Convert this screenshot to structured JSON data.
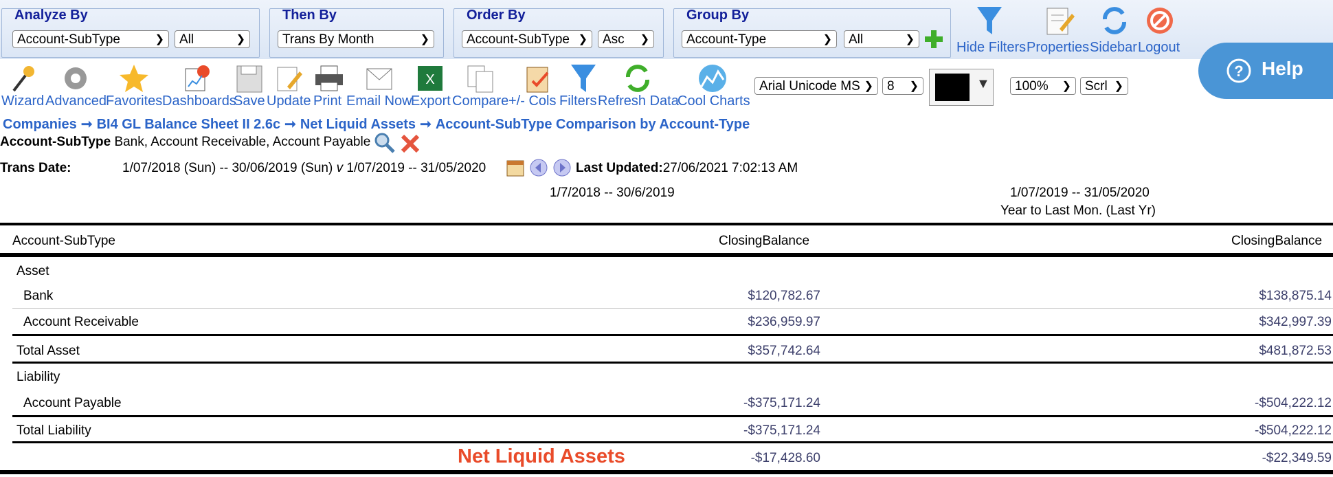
{
  "filters": {
    "analyze_by": {
      "legend": "Analyze By",
      "value": "Account-SubType",
      "sub": "All"
    },
    "then_by": {
      "legend": "Then By",
      "value": "Trans By Month"
    },
    "order_by": {
      "legend": "Order By",
      "value": "Account-SubType",
      "sub": "Asc"
    },
    "group_by": {
      "legend": "Group By",
      "value": "Account-Type",
      "sub": "All"
    }
  },
  "top_actions": [
    "Hide Filters",
    "Properties",
    "Sidebar",
    "Logout"
  ],
  "toolbar": {
    "items": [
      "Wizard",
      "Advanced",
      "Favorites",
      "Dashboards",
      "Save",
      "Update",
      "Print",
      "Email Now",
      "Export",
      "Compare",
      "+/- Cols",
      "Filters",
      "Refresh Data",
      "Cool Charts"
    ],
    "font": "Arial Unicode MS",
    "font_size": "8",
    "zoom": "100%",
    "scroll": "Scrl"
  },
  "help_label": "Help",
  "breadcrumb": [
    "Companies",
    "BI4 GL Balance Sheet II 2.6c",
    "Net Liquid Assets",
    "Account-SubType Comparison by Account-Type"
  ],
  "filter_line": {
    "label": "Account-SubType",
    "values": "Bank, Account Receivable, Account Payable"
  },
  "trans_date": {
    "label": "Trans Date:",
    "range": "1/07/2018 (Sun) -- 30/06/2019 (Sun)",
    "v": "v",
    "range2": "1/07/2019 -- 31/05/2020",
    "last_updated_label": "Last Updated:",
    "last_updated": "27/06/2021 7:02:13 AM"
  },
  "periods": {
    "p1": "1/7/2018 -- 30/6/2019",
    "p2": "1/07/2019 -- 31/05/2020",
    "p2_sub": "Year to Last Mon. (Last Yr)"
  },
  "table": {
    "col_header": "Account-SubType",
    "col1": "ClosingBalance",
    "col2": "ClosingBalance",
    "asset_group": "Asset",
    "bank": {
      "label": "Bank",
      "v1": "$120,782.67",
      "v2": "$138,875.14"
    },
    "ar": {
      "label": "Account Receivable",
      "v1": "$236,959.97",
      "v2": "$342,997.39"
    },
    "total_asset": {
      "label": "Total Asset",
      "v1": "$357,742.64",
      "v2": "$481,872.53"
    },
    "liability_group": "Liability",
    "ap": {
      "label": "Account Payable",
      "v1": "-$375,171.24",
      "v2": "-$504,222.12"
    },
    "total_liability": {
      "label": "Total Liability",
      "v1": "-$375,171.24",
      "v2": "-$504,222.12"
    },
    "net": {
      "label": "Net Liquid Assets",
      "v1": "-$17,428.60",
      "v2": "-$22,349.59"
    }
  },
  "colors": {
    "accent": "#2b64c8",
    "legend": "#13209a",
    "net": "#e94b2a",
    "help": "#4a95d6"
  }
}
